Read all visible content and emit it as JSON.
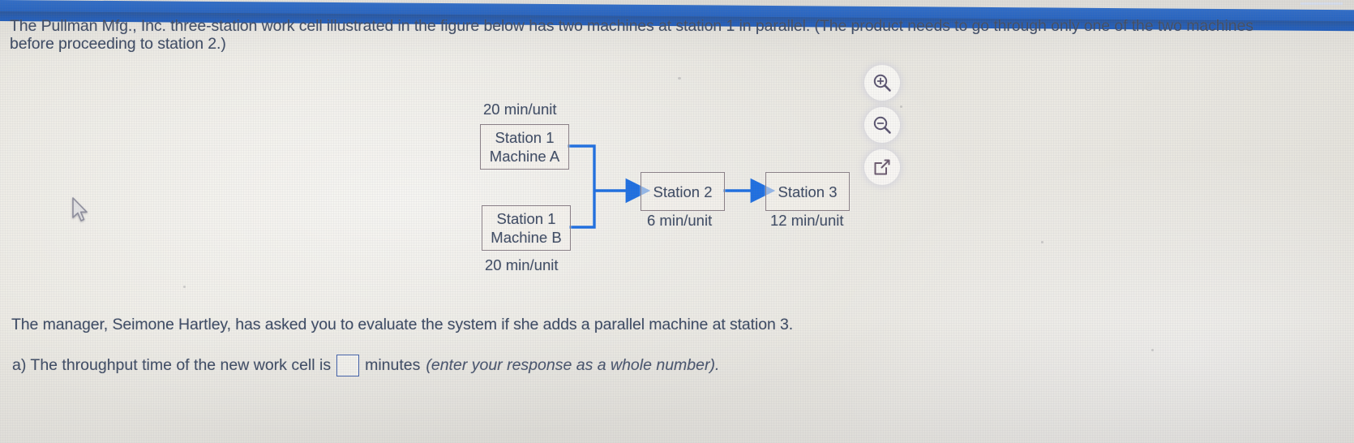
{
  "window": {
    "titlebar_color": "#2060c2"
  },
  "question": {
    "stem_line1": "The Pullman Mfg., Inc. three-station work cell illustrated in the figure below has two machines at station 1 in parallel. (The product needs to go through only one of the two machines",
    "stem_line2": "before proceeding to station 2.)",
    "manager_line": "The manager, Seimone Hartley, has asked you to evaluate the system if she adds a parallel machine at station 3.",
    "part_a_prefix": "a) The throughput time of the new work cell is",
    "answer_value": "",
    "part_a_unit": "minutes",
    "part_a_hint": "(enter your response as a whole number)."
  },
  "diagram": {
    "nodes": [
      {
        "id": "s1a",
        "line1": "Station 1",
        "line2": "Machine A",
        "rate": "20 min/unit",
        "rate_position": "above"
      },
      {
        "id": "s1b",
        "line1": "Station 1",
        "line2": "Machine B",
        "rate": "20 min/unit",
        "rate_position": "below"
      },
      {
        "id": "s2",
        "line1": "Station 2",
        "line2": "",
        "rate": "6 min/unit",
        "rate_position": "below"
      },
      {
        "id": "s3",
        "line1": "Station 3",
        "line2": "",
        "rate": "12 min/unit",
        "rate_position": "below"
      }
    ],
    "arrow_color": "#1f6fe0"
  },
  "tools": [
    {
      "name": "zoom-in",
      "glyph": "magnifier-plus"
    },
    {
      "name": "zoom-out",
      "glyph": "magnifier-minus"
    },
    {
      "name": "pop-out",
      "glyph": "external-link"
    }
  ]
}
